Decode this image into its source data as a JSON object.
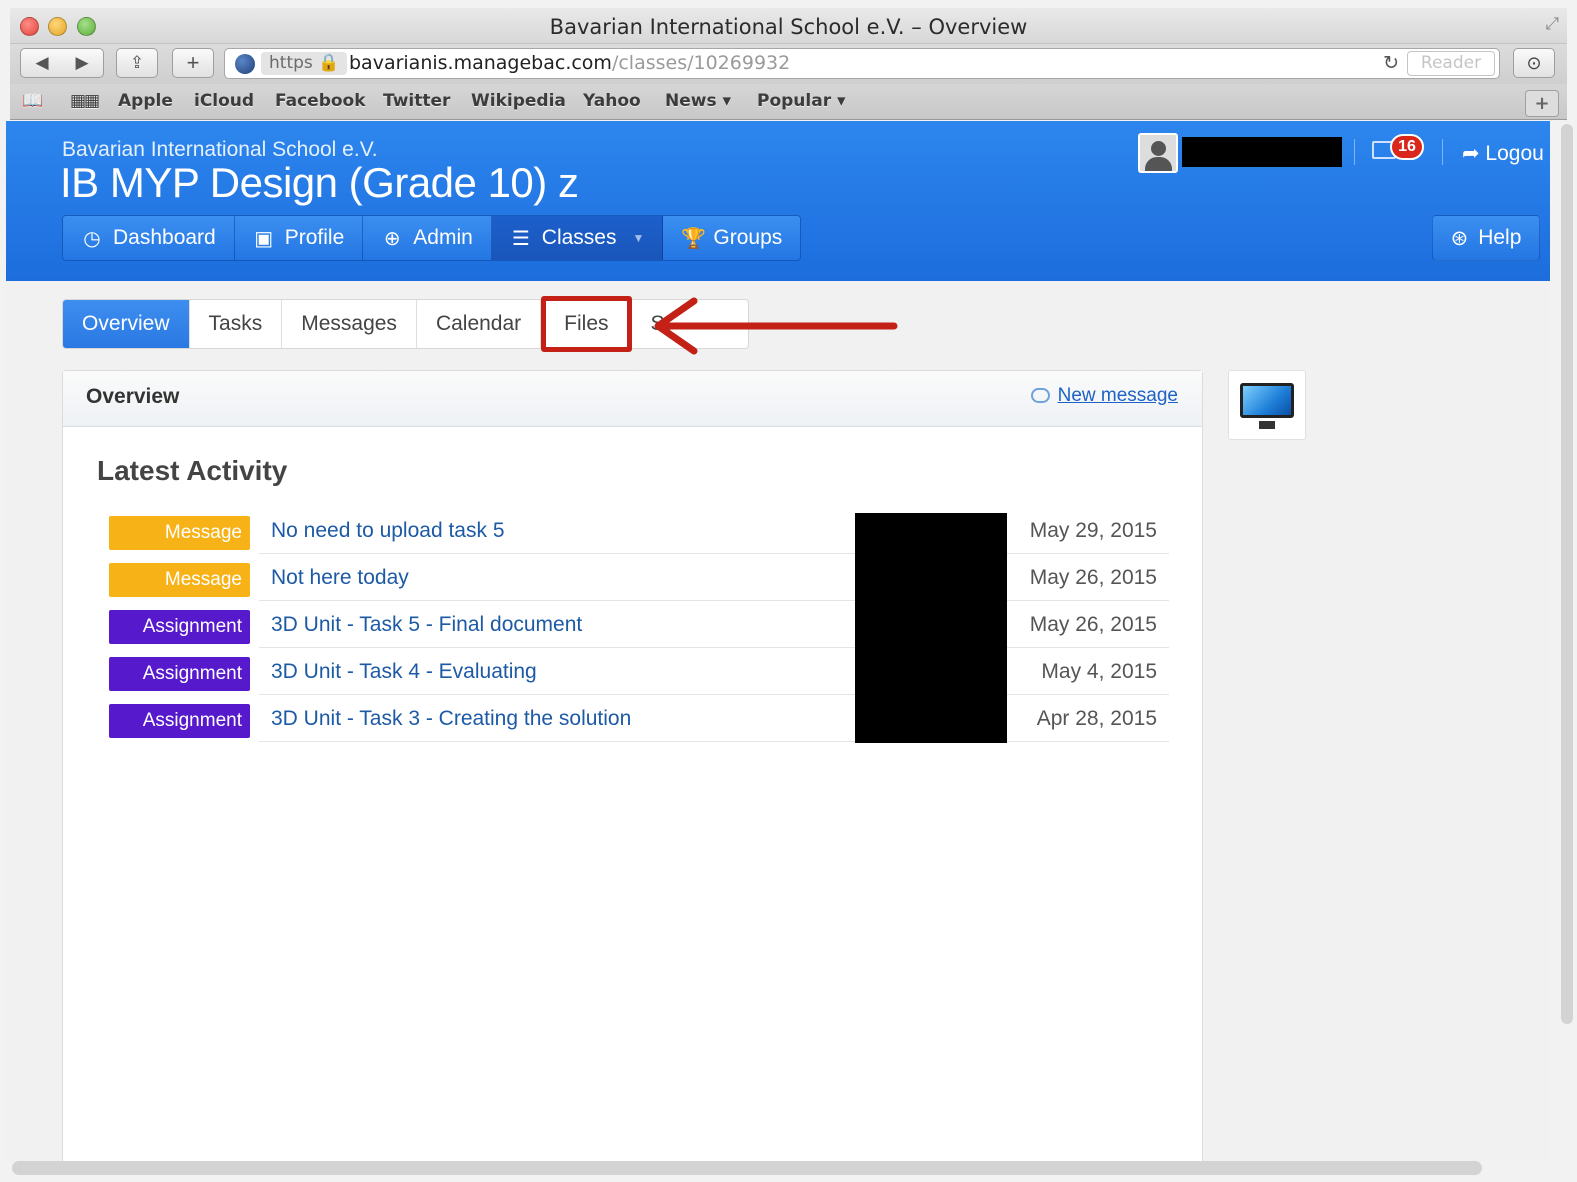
{
  "window": {
    "title": "Bavarian International School e.V. – Overview"
  },
  "toolbar": {
    "back_glyph": "◀",
    "forward_glyph": "▶",
    "share_glyph": "⇪",
    "newtab_glyph": "+",
    "https": "https 🔒",
    "url_host": "bavarianis.managebac.com",
    "url_path": "/classes/10269932",
    "reload_glyph": "↻",
    "reader": "Reader",
    "download_glyph": "⊙"
  },
  "bookmarks": {
    "items": [
      "Apple",
      "iCloud",
      "Facebook",
      "Twitter",
      "Wikipedia",
      "Yahoo",
      "News ▾",
      "Popular ▾"
    ],
    "add": "+"
  },
  "header": {
    "school_name": "Bavarian International School e.V.",
    "class_title": "IB MYP Design (Grade 10) z",
    "mail_count": "16",
    "logout": "➦ Logou",
    "help": "Help"
  },
  "main_nav": {
    "dashboard": "Dashboard",
    "profile": "Profile",
    "admin": "Admin",
    "classes": "Classes",
    "groups": "Groups"
  },
  "sub_tabs": {
    "overview": "Overview",
    "tasks": "Tasks",
    "messages": "Messages",
    "calendar": "Calendar",
    "files": "Files",
    "truncated": "St"
  },
  "panel": {
    "title": "Overview",
    "new_message": "New message",
    "activity_heading": "Latest Activity"
  },
  "activity": [
    {
      "type": "Message",
      "title": "No need to upload task 5",
      "date": "May 29, 2015"
    },
    {
      "type": "Message",
      "title": "Not here today",
      "date": "May 26, 2015"
    },
    {
      "type": "Assignment",
      "title": "3D Unit - Task 5 - Final document",
      "date": "May 26, 2015"
    },
    {
      "type": "Assignment",
      "title": "3D Unit - Task 4 - Evaluating",
      "date": "May 4, 2015"
    },
    {
      "type": "Assignment",
      "title": "3D Unit - Task 3 - Creating the solution",
      "date": "Apr 28, 2015"
    }
  ],
  "colors": {
    "brand_blue": "#2477e4",
    "message_badge": "#f7b217",
    "assignment_badge": "#5619cc",
    "annotation_red": "#c32116"
  }
}
